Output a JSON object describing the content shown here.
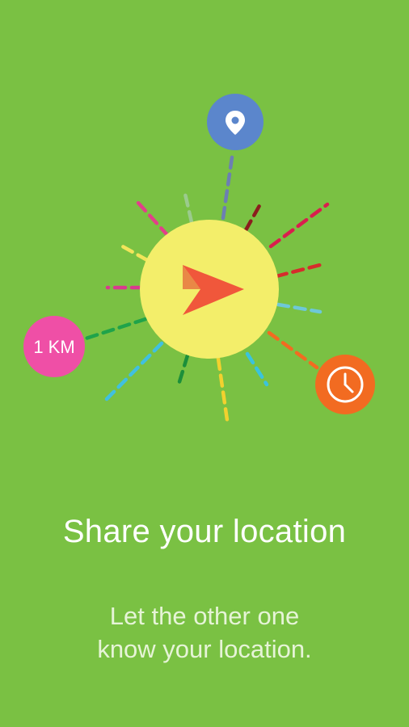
{
  "onboarding": {
    "title": "Share your location",
    "description_lines": [
      "Let the other one",
      "know your location."
    ]
  },
  "illustration": {
    "center_icon": "paper-plane-send-icon",
    "distance_badge": {
      "label": "1 KM",
      "color": "#EF4FA6"
    },
    "location_badge": {
      "icon": "map-pin-icon",
      "color": "#5B86CC"
    },
    "time_badge": {
      "icon": "clock-icon",
      "color": "#F26B21"
    },
    "center_color": "#F3EE6A",
    "arrow_color": "#F0573B",
    "background_color": "#7AC143"
  }
}
